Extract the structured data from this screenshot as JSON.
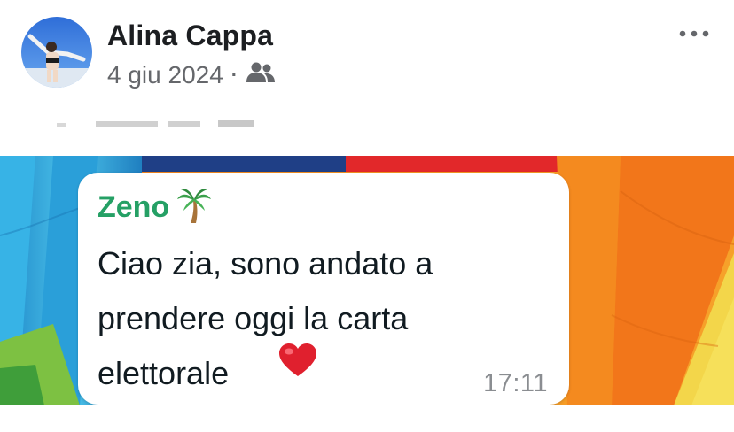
{
  "post": {
    "author_name": "Alina Cappa",
    "date": "4 giu 2024",
    "separator": "·",
    "audience_icon": "friends-icon",
    "more_icon": "more-horizontal-icon"
  },
  "message": {
    "sender_name": "Zeno",
    "sender_emoji": "palm-tree-icon",
    "text": "Ciao zia, sono andato a\nprendere oggi la carta\nelettorale",
    "emoji": "red-heart-icon",
    "time": "17:11"
  },
  "colors": {
    "author_text": "#1c1e21",
    "meta_text": "#65676b",
    "sender_green": "#25a065",
    "heart_red": "#e0202e"
  }
}
